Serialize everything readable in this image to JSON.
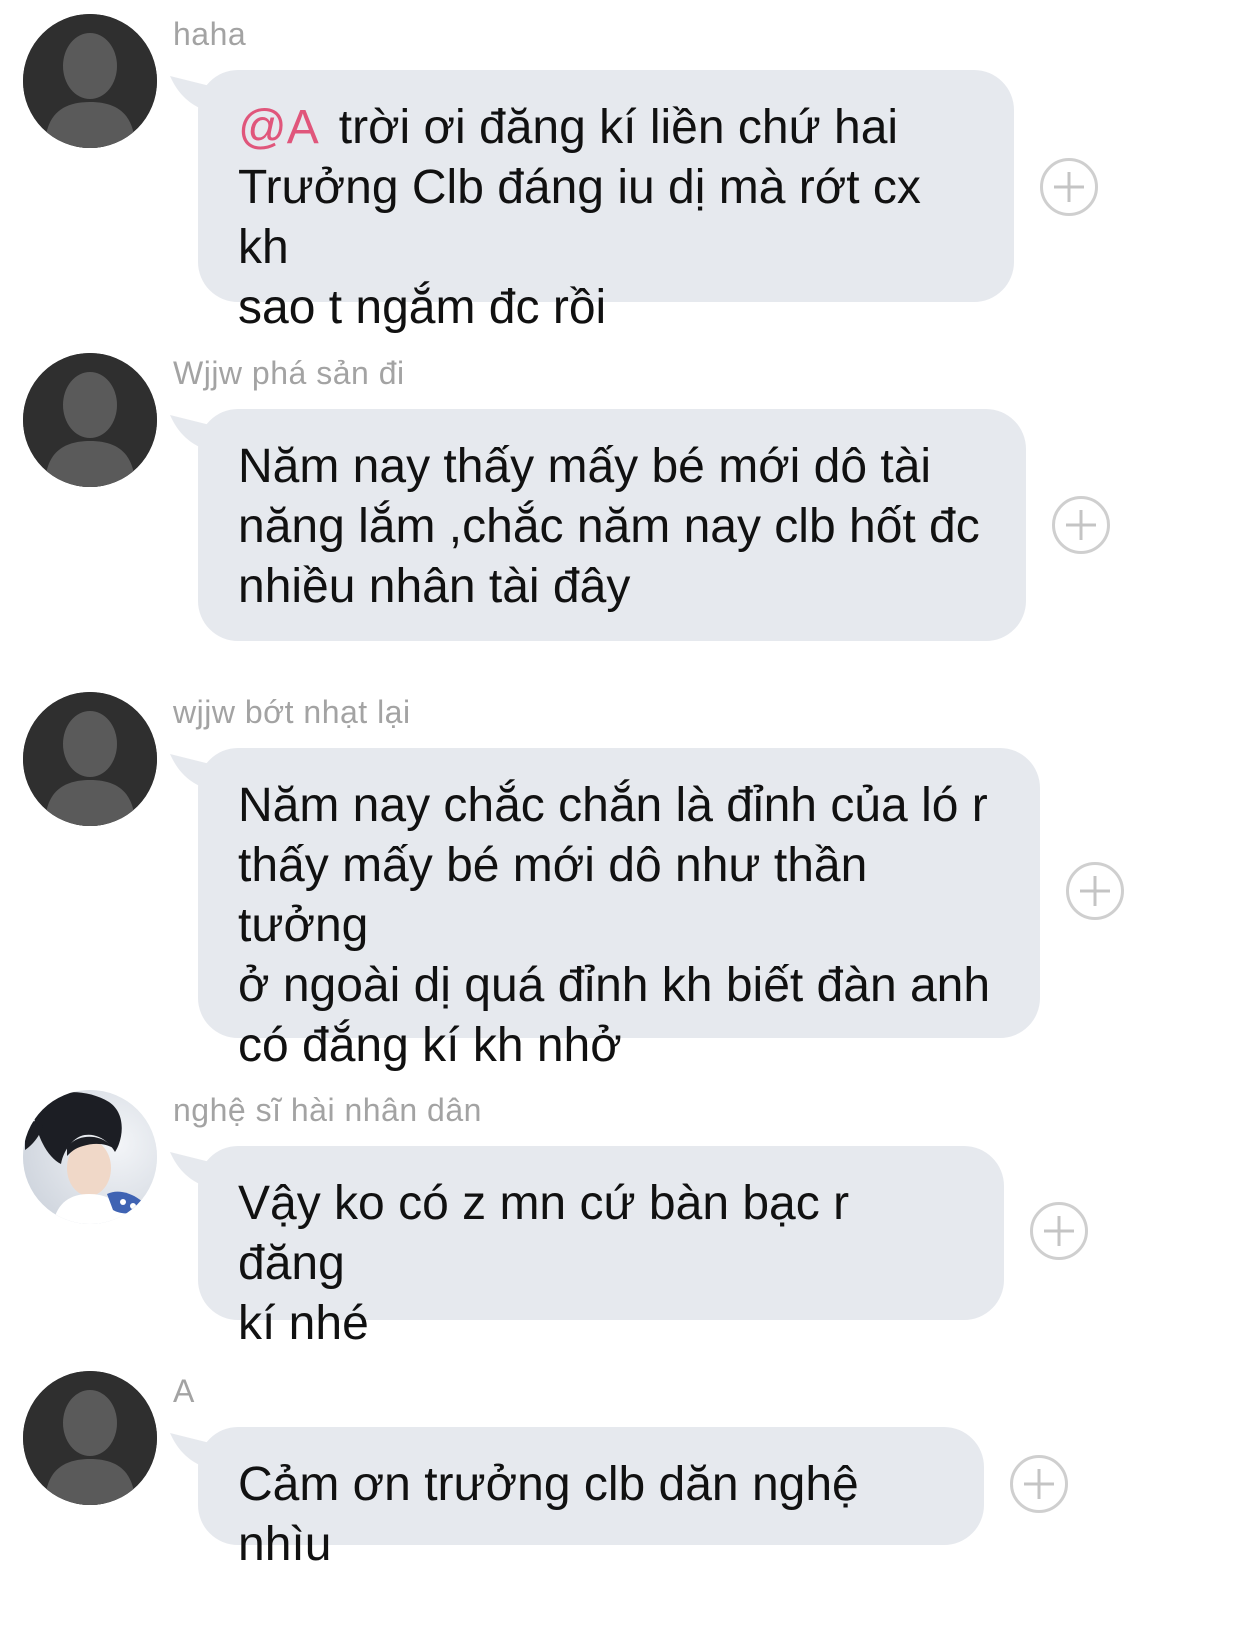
{
  "messages": [
    {
      "sender": "haha",
      "mention": "@A",
      "text": "trời ơi đăng kí liền chứ hai\nTrưởng Clb đáng iu dị mà rớt cx kh\nsao t ngắm đc rồi",
      "avatar": "default-person-icon"
    },
    {
      "sender": "Wjjw phá sản đi",
      "text": "Năm nay thấy mấy bé mới dô tài\nnăng lắm ,chắc năm nay clb hốt đc\nnhiều nhân tài đây",
      "avatar": "default-person-icon"
    },
    {
      "sender": "wjjw bớt nhạt lại",
      "text": "Năm nay chắc chắn là đỉnh của ló r\nthấy mấy bé mới dô như thần tưởng\nở ngoài dị quá đỉnh kh biết đàn anh\ncó đắng kí kh nhở",
      "avatar": "default-person-icon"
    },
    {
      "sender": "nghệ sĩ hài nhân dân",
      "text": "Vậy ko có z mn cứ bàn bạc r đăng\nkí nhé",
      "avatar": "photo-avatar"
    },
    {
      "sender": "A",
      "text": "Cảm ơn trưởng clb dăn nghệ nhìu",
      "avatar": "default-person-icon"
    }
  ],
  "colors": {
    "bubble": "#e6e9ee",
    "mention": "#e0567b",
    "sender": "#a3a3a3",
    "avatar_bg": "#2f2f2f"
  }
}
